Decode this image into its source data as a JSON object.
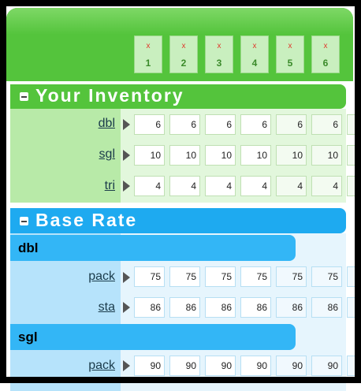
{
  "days": [
    {
      "mark": "x",
      "num": "1"
    },
    {
      "mark": "x",
      "num": "2"
    },
    {
      "mark": "x",
      "num": "3"
    },
    {
      "mark": "x",
      "num": "4"
    },
    {
      "mark": "x",
      "num": "5"
    },
    {
      "mark": "x",
      "num": "6"
    }
  ],
  "inventory": {
    "title": "Your Inventory",
    "rows": [
      {
        "label": "dbl",
        "values": [
          "6",
          "6",
          "6",
          "6",
          "6",
          "6"
        ]
      },
      {
        "label": "sgl",
        "values": [
          "10",
          "10",
          "10",
          "10",
          "10",
          "10"
        ]
      },
      {
        "label": "tri",
        "values": [
          "4",
          "4",
          "4",
          "4",
          "4",
          "4"
        ]
      }
    ]
  },
  "base_rate": {
    "title": "Base Rate",
    "groups": [
      {
        "name": "dbl",
        "rows": [
          {
            "label": "pack",
            "values": [
              "75",
              "75",
              "75",
              "75",
              "75",
              "75"
            ]
          },
          {
            "label": "sta",
            "values": [
              "86",
              "86",
              "86",
              "86",
              "86",
              "86"
            ]
          }
        ]
      },
      {
        "name": "sgl",
        "rows": [
          {
            "label": "pack",
            "values": [
              "90",
              "90",
              "90",
              "90",
              "90",
              "90"
            ]
          }
        ]
      }
    ]
  },
  "colors": {
    "green": "#54c43c",
    "blue": "#1eaaf0",
    "red_x": "#e03a2e"
  }
}
